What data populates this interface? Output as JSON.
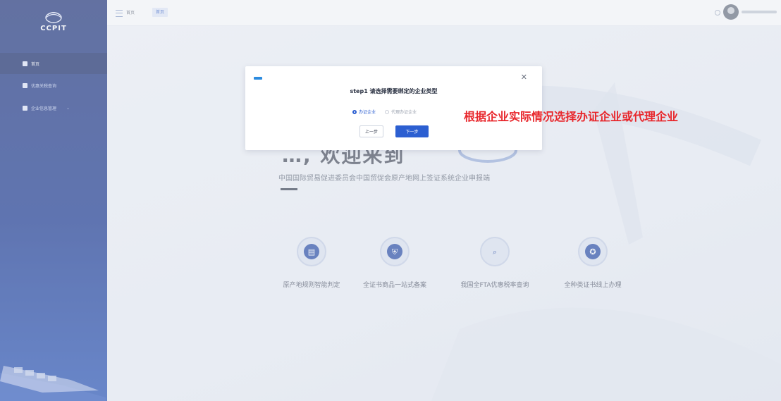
{
  "app": {
    "logo_text": "CCPIT"
  },
  "sidebar": {
    "items": [
      {
        "label": "首页",
        "active": true
      },
      {
        "label": "优惠关税查询",
        "active": false
      },
      {
        "label": "企业信息管理",
        "active": false
      }
    ]
  },
  "header": {
    "breadcrumb": "首页",
    "tab_home": "首页"
  },
  "hero": {
    "title": "…, 欢迎来到",
    "subtitle": "中国国际贸易促进委员会中国贸促会原产地网上签证系统企业申报端"
  },
  "features": [
    {
      "label": "原产地规则智能判定",
      "icon": "document-icon"
    },
    {
      "label": "全证书商品一站式备案",
      "icon": "shield-icon"
    },
    {
      "label": "我国全FTA优惠税率查询",
      "icon": "search-icon"
    },
    {
      "label": "全种类证书线上办理",
      "icon": "badge-icon"
    }
  ],
  "dialog": {
    "title": "step1 请选择需要绑定的企业类型",
    "options": [
      {
        "label": "办证企业",
        "checked": true
      },
      {
        "label": "代理办证企业",
        "checked": false
      }
    ],
    "prev_label": "上一步",
    "next_label": "下一步"
  },
  "annotation": "根据企业实际情况选择办证企业或代理企业",
  "colors": {
    "sidebar": "#1d3a92",
    "primary": "#2c5fd1",
    "annotation": "#e8262b"
  }
}
